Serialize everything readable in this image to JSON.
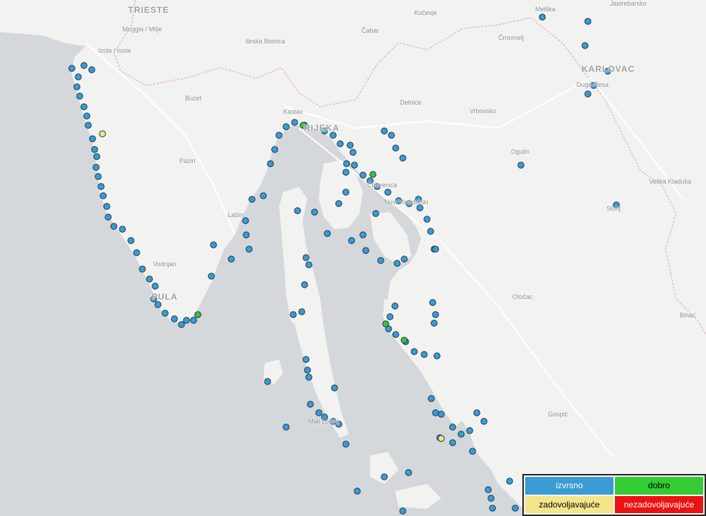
{
  "map": {
    "colors": {
      "sea": "#d4d8db",
      "land": "#f2f2f0",
      "border": "#e7b8c0",
      "road": "#ffffff",
      "excellent": "#3a9bd5",
      "good": "#3fc03a",
      "sufficient": "#f5e58a",
      "insufficient": "#e02020"
    },
    "places": [
      "TRIESTE",
      "Muggia / Milje",
      "Izola / Isola",
      "Kočevje",
      "Čabar",
      "Ilirska Bistrica",
      "Buzet",
      "Pazin",
      "Labin",
      "Vodnjan",
      "PULA",
      "Kastav",
      "RIJEKA",
      "Delnice",
      "Vrbovsko",
      "Črnomelj",
      "Metlika",
      "Jastrebarsko",
      "KARLOVAC",
      "Duga Resa",
      "Ogulin",
      "Velika Kladuša",
      "Slunj",
      "Otočac",
      "Bihać",
      "Gospić",
      "Novi Vinodolski",
      "Crikvenica",
      "Mali Lošinj"
    ],
    "legend": [
      {
        "label": "izvrsno",
        "color": "#3a9bd5",
        "text_color": "#ffffff"
      },
      {
        "label": "dobro",
        "color": "#33cc33",
        "text_color": "#000000"
      },
      {
        "label": "zadovoljavajuće",
        "color": "#f5e58a",
        "text_color": "#000000"
      },
      {
        "label": "nezadovoljavajuće",
        "color": "#ee1111",
        "text_color": "#ffffff"
      }
    ]
  }
}
